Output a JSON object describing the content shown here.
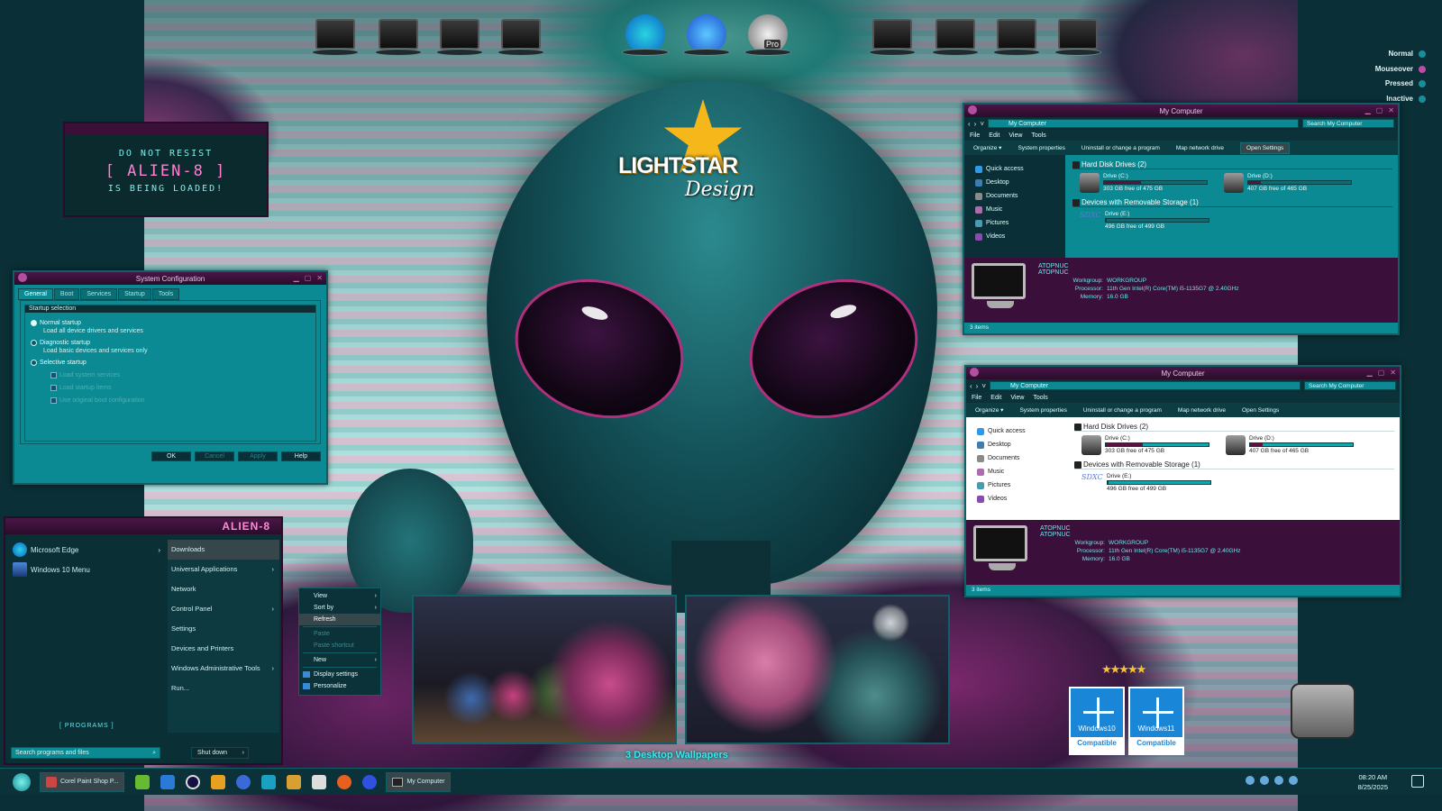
{
  "loading_box": {
    "line1": "DO NOT RESIST",
    "line2": "[ ALIEN-8 ]",
    "line3": "IS BEING LOADED!"
  },
  "logo": {
    "word1": "LIGHTSTAR",
    "word2": "Design"
  },
  "state_labels": [
    {
      "label": "Normal",
      "color": "#1a8e98"
    },
    {
      "label": "Mouseover",
      "color": "#c04aa8"
    },
    {
      "label": "Pressed",
      "color": "#1a8e98"
    },
    {
      "label": "Inactive",
      "color": "#1a8e98"
    }
  ],
  "dock": {
    "icons": [
      "monitor-icon",
      "documents-monitor-icon",
      "network-monitor-icon",
      "task-checklist-icon",
      "edge-icon",
      "thunderbird-icon",
      "google-earth-pro-icon",
      "camera-folder-icon",
      "folder-icon",
      "folder-icon",
      "folder-icon"
    ],
    "pro_label": "Pro"
  },
  "system_config": {
    "title": "System Configuration",
    "tabs": [
      "General",
      "Boot",
      "Services",
      "Startup",
      "Tools"
    ],
    "group_title": "Startup selection",
    "options": [
      {
        "label": "Normal startup",
        "desc": "Load all device drivers and services"
      },
      {
        "label": "Diagnostic startup",
        "desc": "Load basic devices and services only"
      },
      {
        "label": "Selective startup",
        "desc": ""
      }
    ],
    "checks": [
      "Load system services",
      "Load startup items",
      "Use original boot configuration"
    ],
    "buttons": [
      "OK",
      "Cancel",
      "Apply",
      "Help"
    ]
  },
  "start_menu": {
    "title": "ALIEN-8",
    "pinned": [
      {
        "label": "Microsoft Edge",
        "icon": "edge-icon"
      },
      {
        "label": "Windows 10 Menu",
        "icon": "windows-menu-icon"
      }
    ],
    "right_items": [
      {
        "label": "Downloads",
        "arrow": ""
      },
      {
        "label": "Universal Applications",
        "arrow": "›"
      },
      {
        "label": "Network",
        "arrow": ""
      },
      {
        "label": "Control Panel",
        "arrow": "›"
      },
      {
        "label": "Settings",
        "arrow": ""
      },
      {
        "label": "Devices and Printers",
        "arrow": ""
      },
      {
        "label": "Windows Administrative Tools",
        "arrow": "›"
      },
      {
        "label": "Run...",
        "arrow": ""
      }
    ],
    "programs": "[ PROGRAMS ]",
    "search_placeholder": "Search programs and files",
    "shutdown": "Shut down"
  },
  "context_menu": {
    "items": [
      {
        "label": "View",
        "arrow": "›",
        "state": ""
      },
      {
        "label": "Sort by",
        "arrow": "›",
        "state": ""
      },
      {
        "label": "Refresh",
        "arrow": "",
        "state": "hl"
      },
      {
        "label": "",
        "sep": true
      },
      {
        "label": "Paste",
        "arrow": "",
        "state": "dis"
      },
      {
        "label": "Paste shortcut",
        "arrow": "",
        "state": "dis"
      },
      {
        "label": "",
        "sep": true
      },
      {
        "label": "New",
        "arrow": "›",
        "state": ""
      },
      {
        "label": "",
        "sep": true
      },
      {
        "label": "Display settings",
        "arrow": "",
        "state": ""
      },
      {
        "label": "Personalize",
        "arrow": "",
        "state": ""
      }
    ]
  },
  "explorer": {
    "title": "My Computer",
    "address": "My Computer",
    "search_placeholder": "Search My Computer",
    "menu": [
      "File",
      "Edit",
      "View",
      "Tools"
    ],
    "commands": [
      "Organize ▾",
      "System properties",
      "Uninstall or change a program",
      "Map network drive",
      "Open Settings"
    ],
    "nav": [
      {
        "label": "Quick access",
        "color": "#2e9be8"
      },
      {
        "label": "Desktop",
        "color": "#3a7fb0"
      },
      {
        "label": "Documents",
        "color": "#8a8a8a"
      },
      {
        "label": "Music",
        "color": "#b06bb0"
      },
      {
        "label": "Pictures",
        "color": "#4a9ab0"
      },
      {
        "label": "Videos",
        "color": "#8a4ab0"
      }
    ],
    "section_hdd": "Hard Disk Drives (2)",
    "section_rem": "Devices with Removable Storage (1)",
    "drives": [
      {
        "name": "Drive (C:)",
        "free": "303 GB free of 475 GB",
        "used": 0.36
      },
      {
        "name": "Drive (D:)",
        "free": "407 GB free of 465 GB",
        "used": 0.12
      }
    ],
    "removable": {
      "name": "Drive (E:)",
      "free": "496 GB free of 499 GB",
      "used": 0.01,
      "logo": "SDXC"
    },
    "details": {
      "name": "ATOPNUC",
      "sub": "ATOPNUC",
      "rows": [
        {
          "k": "Workgroup:",
          "v": "WORKGROUP"
        },
        {
          "k": "Processor:",
          "v": "11th Gen Intel(R) Core(TM) i5-1135G7 @ 2.40GHz"
        },
        {
          "k": "Memory:",
          "v": "16.0 GB"
        }
      ]
    },
    "status": "3 items"
  },
  "wallpapers_caption": "3 Desktop Wallpapers",
  "badges": [
    {
      "label": "Windows10",
      "sub": "Compatible"
    },
    {
      "label": "Windows11",
      "sub": "Compatible"
    }
  ],
  "taskbar": {
    "tasks": [
      "Corel Paint Shop P...",
      "My Computer"
    ],
    "time": "08:20 AM",
    "date": "8/25/2025"
  }
}
